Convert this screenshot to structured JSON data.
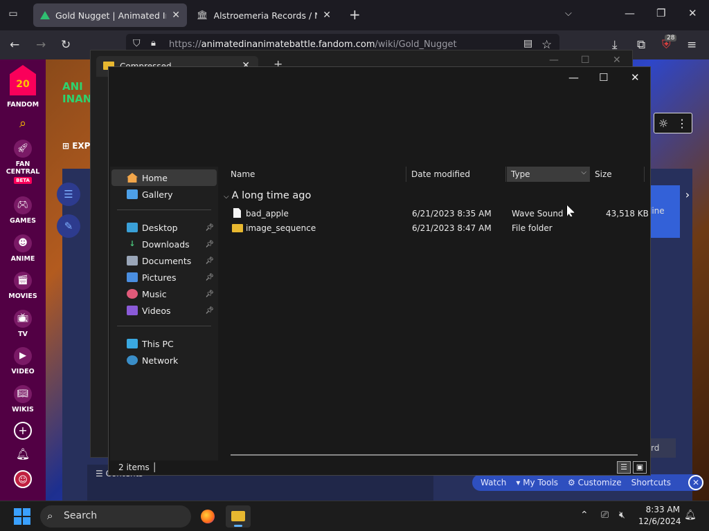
{
  "browser": {
    "tabs": [
      {
        "title": "Gold Nugget | Animated Inanin",
        "active": true
      },
      {
        "title": "Alstroemeria Records / Nomicc",
        "active": false
      }
    ],
    "url_prefix": "https://",
    "url_domain": "animatedinanimatebattle.fandom.com",
    "url_path": "/wiki/Gold_Nugget",
    "extension_badge": "28"
  },
  "fandom": {
    "logo_number": "20",
    "rail": [
      {
        "label": "FANDOM"
      },
      {
        "label": "FAN CENTRAL",
        "badge": "BETA"
      },
      {
        "label": "GAMES"
      },
      {
        "label": "ANIME"
      },
      {
        "label": "MOVIES"
      },
      {
        "label": "TV"
      },
      {
        "label": "VIDEO"
      },
      {
        "label": "WIKIS"
      }
    ],
    "explore": "EXP",
    "right_card_text": "line",
    "card_button": "rd",
    "contents_label": "Contents",
    "toolbar": [
      "Watch",
      "My Tools",
      "Customize",
      "Shortcuts"
    ]
  },
  "bg_explorer": {
    "tab_title": "Compressed"
  },
  "explorer": {
    "sidebar": {
      "top": [
        {
          "label": "Home",
          "icon": "home-icon",
          "selected": true
        },
        {
          "label": "Gallery",
          "icon": "gallery-icon"
        }
      ],
      "quick": [
        {
          "label": "Desktop",
          "icon": "desktop-icon"
        },
        {
          "label": "Downloads",
          "icon": "downloads-icon"
        },
        {
          "label": "Documents",
          "icon": "documents-icon"
        },
        {
          "label": "Pictures",
          "icon": "pictures-icon"
        },
        {
          "label": "Music",
          "icon": "music-icon"
        },
        {
          "label": "Videos",
          "icon": "videos-icon"
        }
      ],
      "bottom": [
        {
          "label": "This PC",
          "icon": "this-pc-icon"
        },
        {
          "label": "Network",
          "icon": "network-icon"
        }
      ]
    },
    "columns": [
      "Name",
      "Date modified",
      "Type",
      "Size"
    ],
    "group": "A long time ago",
    "rows": [
      {
        "name": "bad_apple",
        "date": "6/21/2023 8:35 AM",
        "type": "Wave Sound",
        "size": "43,518 KB",
        "icon": "file-icon"
      },
      {
        "name": "image_sequence",
        "date": "6/21/2023 8:47 AM",
        "type": "File folder",
        "size": "",
        "icon": "folder-icon"
      }
    ],
    "status": "2 items"
  },
  "taskbar": {
    "search": "Search",
    "time": "8:33 AM",
    "date": "12/6/2024"
  }
}
